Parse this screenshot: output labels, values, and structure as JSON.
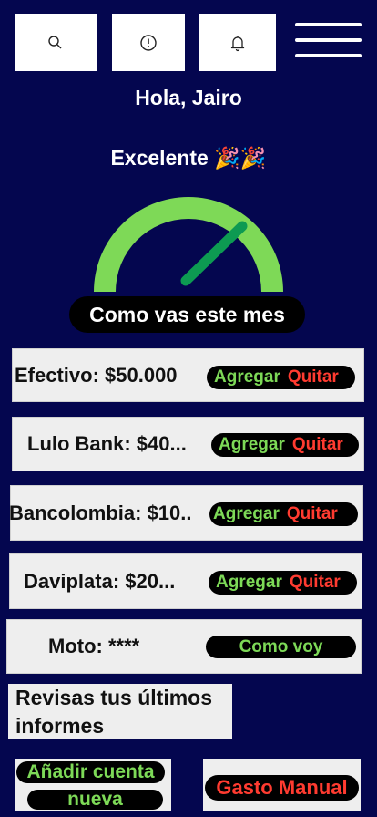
{
  "header": {
    "icons": [
      "search-icon",
      "alert-icon",
      "bell-icon",
      "menu-icon"
    ],
    "greeting": "Hola, Jairo"
  },
  "status": {
    "label": "Excelente",
    "emoji": "🎉🎉",
    "gauge_level": 0.8,
    "caption": "Como vas este mes",
    "colors": {
      "gauge": "#7ed957",
      "needle": "#0d9a52"
    }
  },
  "accounts": [
    {
      "label": "Efectivo: $50.000",
      "add": "Agregar",
      "remove": "Quitar"
    },
    {
      "label": "Lulo Bank: $40...",
      "add": "Agregar",
      "remove": "Quitar"
    },
    {
      "label": "Bancolombia: $10..",
      "add": "Agregar",
      "remove": "Quitar"
    },
    {
      "label": "Daviplata: $20...",
      "add": "Agregar",
      "remove": "Quitar"
    }
  ],
  "goal": {
    "label": "Moto: ****",
    "action": "Como voy"
  },
  "reports": {
    "label": "Revisas tus últimos informes"
  },
  "footer": {
    "add_account_line1": "Añadir cuenta",
    "add_account_line2": "nueva",
    "manual_expense": "Gasto Manual"
  },
  "theme": {
    "background": "#04064f",
    "green": "#7dd957",
    "red": "#ff3b30"
  }
}
